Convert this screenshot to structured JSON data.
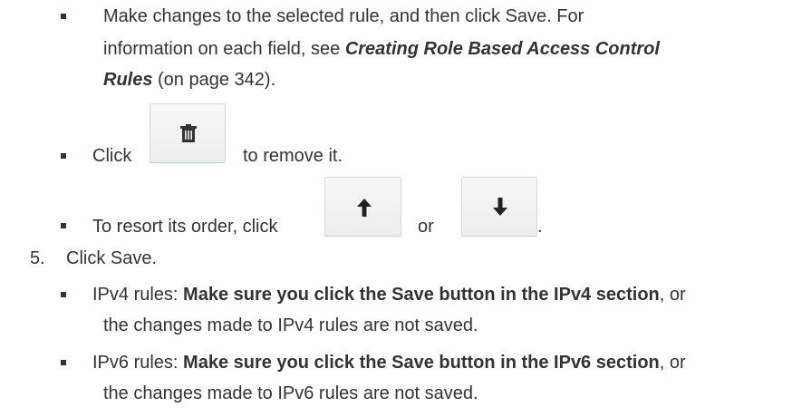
{
  "step4_bullets": {
    "edit": {
      "line1": "Make changes to the selected rule, and then click Save. For",
      "line2_prefix": "information on each field, see ",
      "link_part1": "Creating Role Based Access Control",
      "link_part2": "Rules",
      "page_ref": " (on page 342)."
    },
    "delete": {
      "prefix": "Click",
      "suffix": "to remove it.",
      "icon": "trash-icon"
    },
    "reorder": {
      "prefix": "To resort its order, click",
      "or": "or",
      "end": ".",
      "up_icon": "arrow-up-icon",
      "down_icon": "arrow-down-icon"
    }
  },
  "step5": {
    "number": "5.",
    "text": "Click Save.",
    "ipv4": {
      "label": "IPv4 rules: ",
      "bold": "Make sure you click the Save button in the IPv4 section",
      "rest": ", or",
      "line2": "the changes made to IPv4 rules are not saved."
    },
    "ipv6": {
      "label": "IPv6 rules: ",
      "bold": "Make sure you click the Save button in the IPv6 section",
      "rest": ", or",
      "line2": "the changes made to IPv6 rules are not saved."
    }
  }
}
